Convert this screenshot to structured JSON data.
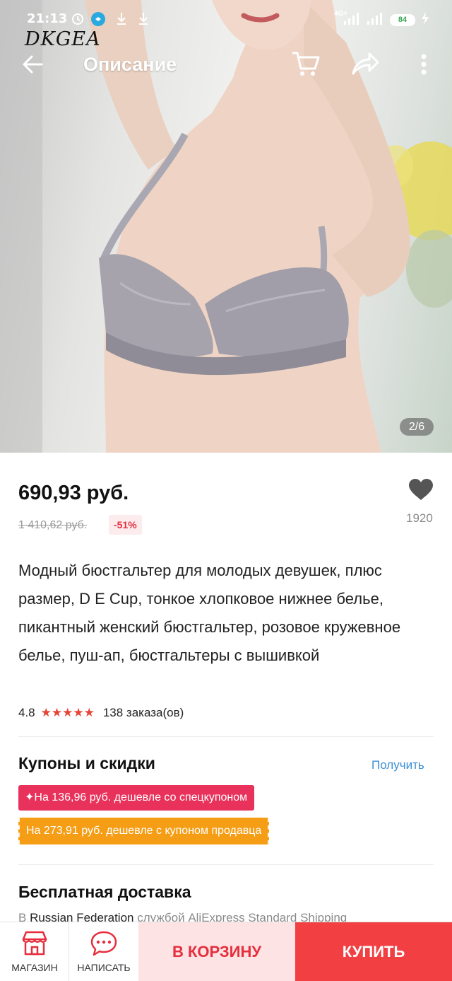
{
  "statusbar": {
    "time": "21:13",
    "network": "4G+",
    "battery": "84"
  },
  "header": {
    "brand": "DKGEA",
    "title": "Описание",
    "page_indicator": "2/6"
  },
  "product": {
    "price": "690,93 руб.",
    "old_price": "1 410,62 руб.",
    "discount": "-51%",
    "wishlist_count": "1920",
    "title": "Модный бюстгальтер для молодых девушек, плюс размер, D E Cup, тонкое хлопковое нижнее белье, пикантный женский бюстгальтер, розовое кружевное белье, пуш-ап, бюстгальтеры с вышивкой",
    "rating": "4.8",
    "stars": "★★★★★",
    "orders": "138 заказа(ов)"
  },
  "coupons": {
    "title": "Купоны и скидки",
    "link": "Получить",
    "special": "✦На 136,96 руб. дешевле со спецкупоном",
    "seller": "На 273,91 руб. дешевле с купоном продавца"
  },
  "shipping": {
    "title": "Бесплатная доставка",
    "prefix": "В",
    "country": "Russian Federation",
    "suffix": "службой AliExpress Standard Shipping"
  },
  "bottom": {
    "store": "МАГАЗИН",
    "message": "НАПИСАТЬ",
    "add_to_cart": "В КОРЗИНУ",
    "buy": "КУПИТЬ"
  },
  "colors": {
    "accent": "#f23f42",
    "cart_bg": "#fde3e3",
    "coupon_pink": "#e8325b",
    "coupon_orange": "#f59d14",
    "link": "#3b8fd6"
  },
  "icons": [
    "back-arrow-icon",
    "cart-icon",
    "share-icon",
    "more-icon",
    "heart-icon",
    "store-icon",
    "chat-icon"
  ]
}
